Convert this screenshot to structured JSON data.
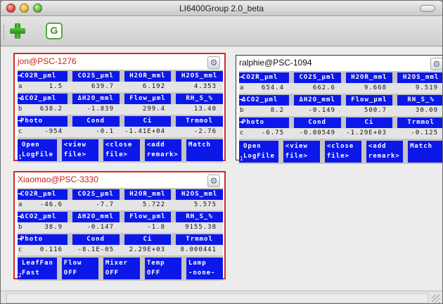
{
  "window": {
    "title": "LI6400Group 2.0_beta"
  },
  "toolbar": {
    "add_icon": "plus-icon",
    "g_label": "G"
  },
  "panels": [
    {
      "name": "jon@PSC-1276",
      "border": "#d42a2a",
      "rows": [
        {
          "headers": [
            "CO2R_µml",
            "CO2S_µml",
            "H2OR_mml",
            "H2OS_mml"
          ],
          "letter": "a",
          "values": [
            "1.5",
            "639.7",
            "6.192",
            "4.353"
          ]
        },
        {
          "headers": [
            "ΔCO2_µml",
            "ΔH2O_mml",
            "Flow_µml",
            "RH_S_%"
          ],
          "letter": "b",
          "values": [
            "638.2",
            "-1.839",
            "299.4",
            "13.40"
          ]
        },
        {
          "headers": [
            "Photo",
            "Cond",
            "Ci",
            "Trmmol"
          ],
          "letter": "c",
          "values": [
            "-954",
            "-0.1",
            "-1.41E+04",
            "-2.76"
          ]
        }
      ],
      "buttons": [
        "Open\nLogFile",
        "<view\nfile>",
        "<close\nfile>",
        "<add\nremark>",
        "Match"
      ],
      "button_row_num": "1"
    },
    {
      "name": "ralphie@PSC-1094",
      "border": "#333333",
      "rows": [
        {
          "headers": [
            "CO2R_µml",
            "CO2S_µml",
            "H2OR_mml",
            "H2OS_mml"
          ],
          "letter": "a",
          "values": [
            "654.4",
            "662.6",
            "9.668",
            "9.519"
          ]
        },
        {
          "headers": [
            "ΔCO2_µml",
            "ΔH2O_mml",
            "Flow_µml",
            "RH_S_%"
          ],
          "letter": "b",
          "values": [
            "8.2",
            "-0.149",
            "500.7",
            "30.09"
          ]
        },
        {
          "headers": [
            "Photo",
            "Cond",
            "Ci",
            "Trmmol"
          ],
          "letter": "c",
          "values": [
            "-6.75",
            "-0.00549",
            "-1.29E+03",
            "-0.125"
          ]
        }
      ],
      "buttons": [
        "Open\nLogFile",
        "<view\nfile>",
        "<close\nfile>",
        "<add\nremark>",
        "Match"
      ],
      "button_row_num": "1"
    },
    {
      "name": "Xiaomao@PSC-3330",
      "border": "#d42a2a",
      "rows": [
        {
          "headers": [
            "CO2R_µml",
            "CO2S_µml",
            "H2OR_mml",
            "H2OS_mml"
          ],
          "letter": "a",
          "values": [
            "-46.6",
            "-7.7",
            "5.722",
            "5.575"
          ]
        },
        {
          "headers": [
            "ΔCO2_µml",
            "ΔH2O_mml",
            "Flow_µml",
            "RH_S_%"
          ],
          "letter": "b",
          "values": [
            "38.9",
            "-0.147",
            "-1.8",
            "9155.38"
          ]
        },
        {
          "headers": [
            "Photo",
            "Cond",
            "Ci",
            "Trmmol"
          ],
          "letter": "c",
          "values": [
            "0.116",
            "-8.1E-05",
            "2.29E+03",
            "0.000441"
          ]
        }
      ],
      "buttons": [
        "LeafFan\nFast",
        "Flow\nOFF",
        "Mixer\nOFF",
        "Temp\nOFF",
        "Lamp\n-none-"
      ],
      "button_row_num": "2"
    }
  ]
}
